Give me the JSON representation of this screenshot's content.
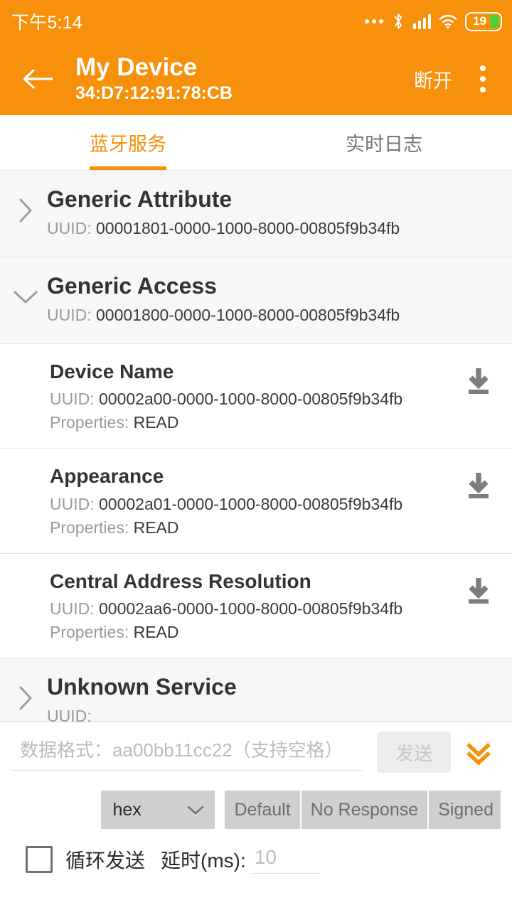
{
  "status_bar": {
    "time": "下午5:14",
    "icons": [
      "more-dots-icon",
      "bluetooth-icon",
      "signal-icon",
      "wifi-icon",
      "battery-icon"
    ],
    "battery_level": "19"
  },
  "app_bar": {
    "back_icon": "arrow-left-icon",
    "title": "My Device",
    "subtitle": "34:D7:12:91:78:CB",
    "disconnect_label": "断开",
    "overflow_icon": "more-vertical-icon",
    "accent_color": "#F7900B"
  },
  "tabs": [
    {
      "label": "蓝牙服务",
      "active": true
    },
    {
      "label": "实时日志",
      "active": false
    }
  ],
  "services": [
    {
      "name": "Generic Attribute",
      "uuid_label": "UUID: ",
      "uuid": "00001801-0000-1000-8000-00805f9b34fb",
      "expanded": false,
      "chevron": "chevron-right-icon"
    },
    {
      "name": "Generic Access",
      "uuid_label": "UUID: ",
      "uuid": "00001800-0000-1000-8000-00805f9b34fb",
      "expanded": true,
      "chevron": "chevron-down-icon"
    },
    {
      "name": "Unknown Service",
      "uuid_label": "UUID: ",
      "uuid": "",
      "expanded": false,
      "chevron": "chevron-right-icon"
    }
  ],
  "characteristics": [
    {
      "name": "Device Name",
      "uuid_label": "UUID: ",
      "uuid": "00002a00-0000-1000-8000-00805f9b34fb",
      "props_label": "Properties: ",
      "props": "READ",
      "action_icon": "download-icon"
    },
    {
      "name": "Appearance",
      "uuid_label": "UUID: ",
      "uuid": "00002a01-0000-1000-8000-00805f9b34fb",
      "props_label": "Properties: ",
      "props": "READ",
      "action_icon": "download-icon"
    },
    {
      "name": "Central Address Resolution",
      "uuid_label": "UUID: ",
      "uuid": "00002aa6-0000-1000-8000-00805f9b34fb",
      "props_label": "Properties: ",
      "props": "READ",
      "action_icon": "download-icon"
    }
  ],
  "bottom_panel": {
    "data_input": {
      "value": "",
      "placeholder": "数据格式：aa00bb11cc22（支持空格）"
    },
    "send_label": "发送",
    "send_disabled": true,
    "expand_icon": "chevron-double-down-icon",
    "format_select": {
      "value": "hex",
      "caret_icon": "chevron-down-icon"
    },
    "write_modes": [
      "Default",
      "No Response",
      "Signed"
    ],
    "loop_checkbox": {
      "label": "循环发送",
      "checked": false
    },
    "delay_label": "延时(ms):",
    "delay_input": {
      "value": "",
      "placeholder": "10"
    }
  }
}
